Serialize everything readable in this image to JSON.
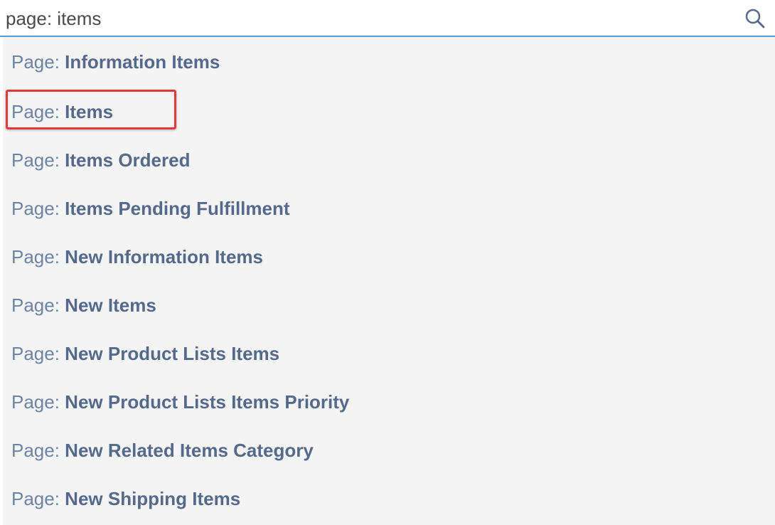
{
  "search": {
    "value": "page: items"
  },
  "results": [
    {
      "prefix": "Page: ",
      "name": "Information Items"
    },
    {
      "prefix": "Page: ",
      "name": "Items"
    },
    {
      "prefix": "Page: ",
      "name": "Items Ordered"
    },
    {
      "prefix": "Page: ",
      "name": "Items Pending Fulfillment"
    },
    {
      "prefix": "Page: ",
      "name": "New Information Items"
    },
    {
      "prefix": "Page: ",
      "name": "New Items"
    },
    {
      "prefix": "Page: ",
      "name": "New Product Lists Items"
    },
    {
      "prefix": "Page: ",
      "name": "New Product Lists Items Priority"
    },
    {
      "prefix": "Page: ",
      "name": "New Related Items Category"
    },
    {
      "prefix": "Page: ",
      "name": "New Shipping Items"
    }
  ],
  "colors": {
    "accent_underline": "#5b9bd5",
    "highlight_border": "#e03a3a",
    "prefix_text": "#6e83a3",
    "name_text": "#55698b",
    "list_background": "#f4f4f5"
  },
  "icons": {
    "search": "search-icon"
  }
}
